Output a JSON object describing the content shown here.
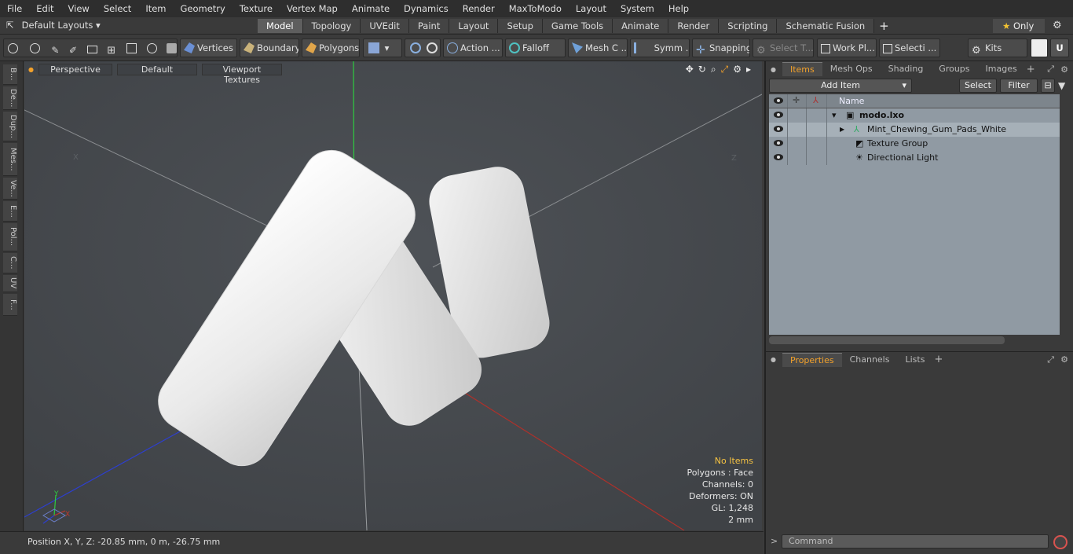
{
  "menu": [
    "File",
    "Edit",
    "View",
    "Select",
    "Item",
    "Geometry",
    "Texture",
    "Vertex Map",
    "Animate",
    "Dynamics",
    "Render",
    "MaxToModo",
    "Layout",
    "System",
    "Help"
  ],
  "layouts_dropdown": "Default Layouts",
  "layout_tabs": [
    "Model",
    "Topology",
    "UVEdit",
    "Paint",
    "Layout",
    "Setup",
    "Game Tools",
    "Animate",
    "Render",
    "Scripting",
    "Schematic Fusion"
  ],
  "active_layout_tab": "Model",
  "only_label": "Only",
  "toolbar": {
    "vertices": "Vertices",
    "boundary": "Boundary",
    "polygons": "Polygons",
    "action": "Action ...",
    "falloff": "Falloff",
    "mesh": "Mesh C ...",
    "symm": "Symm ...",
    "snapping": "Snapping",
    "select_t": "Select T...",
    "work_pl": "Work Pl...",
    "selecti": "Selecti ...",
    "kits": "Kits"
  },
  "left_tabs": [
    "B...",
    "De...",
    "Dup...",
    "Mes...",
    "Ve...",
    "E...",
    "Pol...",
    "C...",
    "UV",
    "F..."
  ],
  "viewport": {
    "view_mode": "Perspective",
    "shading": "Default",
    "textures": "Viewport Textures",
    "axis_labels": {
      "x": "X",
      "y": "Y",
      "z": "Z"
    },
    "stats": {
      "items": "No Items",
      "polygons": "Polygons : Face",
      "channels": "Channels: 0",
      "deformers": "Deformers: ON",
      "gl": "GL: 1,248",
      "unit": "2 mm"
    }
  },
  "status": "Position X, Y, Z:   -20.85 mm, 0 m, -26.75 mm",
  "items_panel": {
    "tabs": [
      "Items",
      "Mesh Ops",
      "Shading",
      "Groups",
      "Images"
    ],
    "add_item": "Add Item",
    "select": "Select",
    "filter": "Filter",
    "column_name": "Name",
    "items": [
      {
        "name": "modo.lxo"
      },
      {
        "name": "Mint_Chewing_Gum_Pads_White"
      },
      {
        "name": "Texture Group"
      },
      {
        "name": "Directional Light"
      }
    ]
  },
  "properties_panel": {
    "tabs": [
      "Properties",
      "Channels",
      "Lists"
    ]
  },
  "command_placeholder": "Command",
  "colors": {
    "accent": "#f2a12b",
    "x_axis": "#c0392b",
    "y_axis": "#2ecc40",
    "z_axis": "#2d3fd0"
  }
}
